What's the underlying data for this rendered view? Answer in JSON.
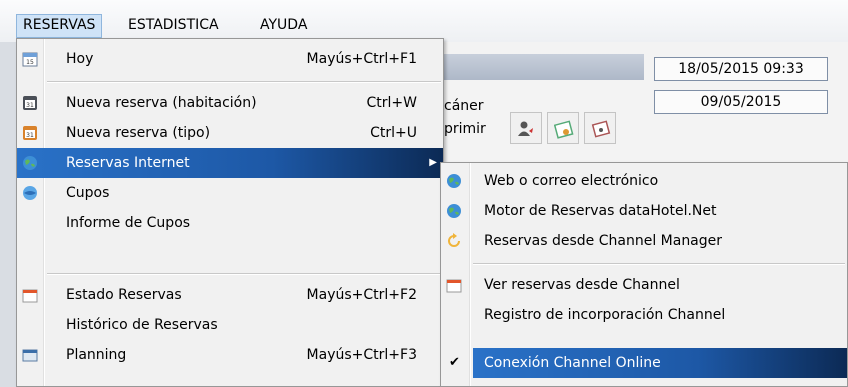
{
  "menubar": {
    "items": [
      {
        "label": "RESERVAS"
      },
      {
        "label": "ESTADISTICA"
      },
      {
        "label": "AYUDA"
      }
    ]
  },
  "background_window": {
    "datetime": "18/05/2015 09:33",
    "date": "09/05/2015",
    "scanner_fragment": "cáner",
    "print_fragment": "primir"
  },
  "main_menu": {
    "items": [
      {
        "label": "Hoy",
        "shortcut": "Mayús+Ctrl+F1",
        "icon": "calendar-15-icon"
      },
      {
        "label": "Nueva reserva (habitación)",
        "shortcut": "Ctrl+W",
        "icon": "calendar-31-icon"
      },
      {
        "label": "Nueva reserva (tipo)",
        "shortcut": "Ctrl+U",
        "icon": "calendar-31-orange-icon"
      },
      {
        "label": "Reservas Internet",
        "shortcut": "",
        "icon": "globe-icon"
      },
      {
        "label": "Cupos",
        "shortcut": "",
        "icon": "globe-blue-icon"
      },
      {
        "label": "Informe de Cupos",
        "shortcut": "",
        "icon": ""
      },
      {
        "label": "Estado Reservas",
        "shortcut": "Mayús+Ctrl+F2",
        "icon": "calendar-page-icon"
      },
      {
        "label": "Histórico de Reservas",
        "shortcut": "",
        "icon": ""
      },
      {
        "label": "Planning",
        "shortcut": "Mayús+Ctrl+F3",
        "icon": "planning-icon"
      }
    ]
  },
  "submenu": {
    "items": [
      {
        "label": "Web o correo electrónico",
        "icon": "globe-icon"
      },
      {
        "label": "Motor de Reservas dataHotel.Net",
        "icon": "globe-icon"
      },
      {
        "label": "Reservas desde Channel Manager",
        "icon": "refresh-icon"
      },
      {
        "label": "Ver reservas desde Channel",
        "icon": "calendar-page-icon"
      },
      {
        "label": "Registro de incorporación Channel",
        "icon": ""
      },
      {
        "label": "Conexión Channel Online",
        "icon": "checkmark-icon",
        "checked": true
      }
    ]
  },
  "colors": {
    "highlight_start": "#2a72c8",
    "highlight_end": "#0c2a55",
    "menu_bg": "#f1f1f1"
  }
}
